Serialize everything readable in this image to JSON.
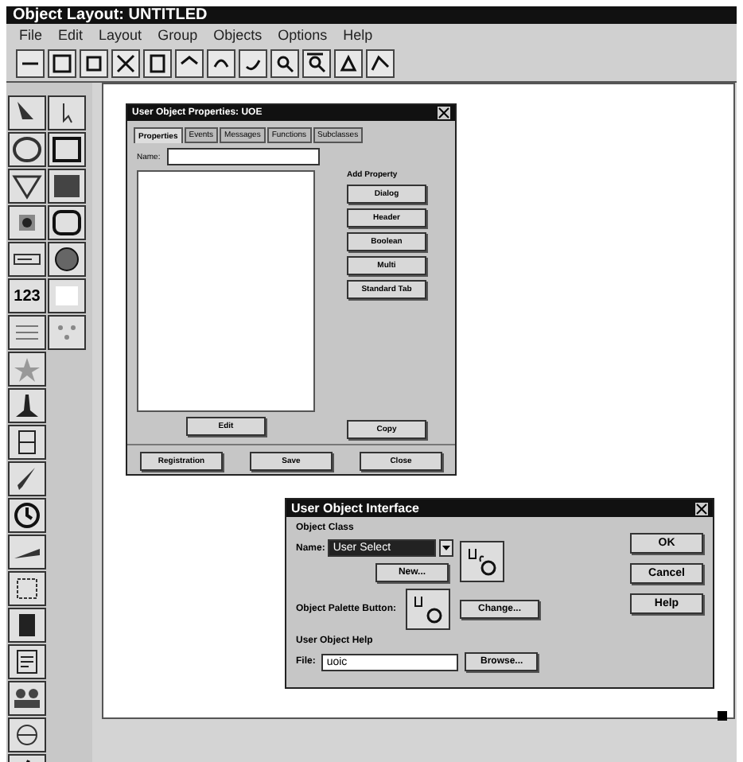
{
  "window": {
    "title": "Object Layout: UNTITLED"
  },
  "menu": [
    "File",
    "Edit",
    "Layout",
    "Group",
    "Objects",
    "Options",
    "Help"
  ],
  "palette": {
    "number_tool": "123"
  },
  "properties_dialog": {
    "title": "User Object Properties: UOE",
    "tabs": [
      {
        "label": "Properties",
        "selected": true
      },
      {
        "label": "Events",
        "selected": false
      },
      {
        "label": "Messages",
        "selected": false
      },
      {
        "label": "Functions",
        "selected": false
      },
      {
        "label": "Subclasses",
        "selected": false
      }
    ],
    "name_label": "Name:",
    "add_label": "Add Property",
    "add_buttons": [
      "Dialog",
      "Header",
      "Boolean",
      "Multi",
      "Standard Tab"
    ],
    "side_buttons": [
      "Copy"
    ],
    "edit_button": "Edit",
    "bottom_buttons": [
      "Registration",
      "Save",
      "Close"
    ]
  },
  "interface_dialog": {
    "title": "User Object Interface",
    "class_group": "Object Class",
    "name_label": "Name:",
    "name_value": "User Select",
    "new_button": "New...",
    "palette_label": "Object Palette Button:",
    "change_button": "Change...",
    "help_group": "User Object Help",
    "file_label": "File:",
    "file_value": "uoic",
    "browse_button": "Browse...",
    "buttons": [
      "OK",
      "Cancel",
      "Help"
    ]
  }
}
